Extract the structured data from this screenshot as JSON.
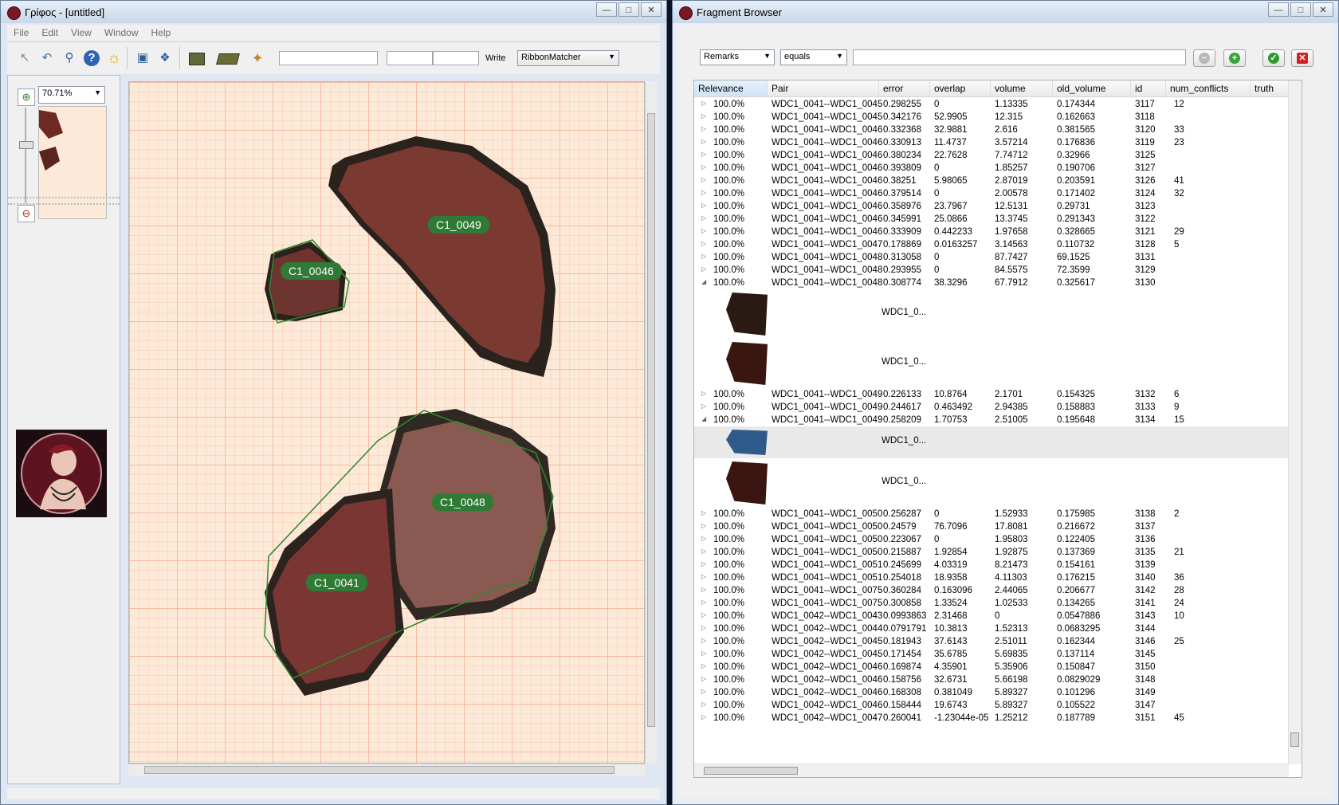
{
  "left_window": {
    "title": "Γρίφος - [untitled]",
    "menu": [
      "File",
      "Edit",
      "View",
      "Window",
      "Help"
    ],
    "toolbar": {
      "write_label": "Write",
      "matcher_select": "RibbonMatcher"
    },
    "zoom": "70.71%",
    "fragments": [
      {
        "id": "C1_0049"
      },
      {
        "id": "C1_0046"
      },
      {
        "id": "C1_0048"
      },
      {
        "id": "C1_0041"
      }
    ]
  },
  "right_window": {
    "title": "Fragment Browser",
    "filter": {
      "field": "Remarks",
      "operator": "equals",
      "value": ""
    },
    "columns": [
      "Relevance",
      "Pair",
      "error",
      "overlap",
      "volume",
      "old_volume",
      "id",
      "num_conflicts",
      "truth"
    ],
    "rows": [
      {
        "type": "row",
        "expanded": false,
        "relevance": "100.0%",
        "pair": "WDC1_0041--WDC1_0045",
        "error": "0.298255",
        "overlap": "0",
        "volume": "1.13335",
        "old_volume": "0.174344",
        "id": "3117",
        "num_conflicts": "12"
      },
      {
        "type": "row",
        "expanded": false,
        "relevance": "100.0%",
        "pair": "WDC1_0041--WDC1_0045",
        "error": "0.342176",
        "overlap": "52.9905",
        "volume": "12.315",
        "old_volume": "0.162663",
        "id": "3118",
        "num_conflicts": ""
      },
      {
        "type": "row",
        "expanded": false,
        "relevance": "100.0%",
        "pair": "WDC1_0041--WDC1_0046",
        "error": "0.332368",
        "overlap": "32.9881",
        "volume": "2.616",
        "old_volume": "0.381565",
        "id": "3120",
        "num_conflicts": "33"
      },
      {
        "type": "row",
        "expanded": false,
        "relevance": "100.0%",
        "pair": "WDC1_0041--WDC1_0046",
        "error": "0.330913",
        "overlap": "11.4737",
        "volume": "3.57214",
        "old_volume": "0.176836",
        "id": "3119",
        "num_conflicts": "23"
      },
      {
        "type": "row",
        "expanded": false,
        "relevance": "100.0%",
        "pair": "WDC1_0041--WDC1_0046",
        "error": "0.380234",
        "overlap": "22.7628",
        "volume": "7.74712",
        "old_volume": "0.32966",
        "id": "3125",
        "num_conflicts": ""
      },
      {
        "type": "row",
        "expanded": false,
        "relevance": "100.0%",
        "pair": "WDC1_0041--WDC1_0046",
        "error": "0.393809",
        "overlap": "0",
        "volume": "1.85257",
        "old_volume": "0.190706",
        "id": "3127",
        "num_conflicts": ""
      },
      {
        "type": "row",
        "expanded": false,
        "relevance": "100.0%",
        "pair": "WDC1_0041--WDC1_0046",
        "error": "0.38251",
        "overlap": "5.98065",
        "volume": "2.87019",
        "old_volume": "0.203591",
        "id": "3126",
        "num_conflicts": "41"
      },
      {
        "type": "row",
        "expanded": false,
        "relevance": "100.0%",
        "pair": "WDC1_0041--WDC1_0046",
        "error": "0.379514",
        "overlap": "0",
        "volume": "2.00578",
        "old_volume": "0.171402",
        "id": "3124",
        "num_conflicts": "32"
      },
      {
        "type": "row",
        "expanded": false,
        "relevance": "100.0%",
        "pair": "WDC1_0041--WDC1_0046",
        "error": "0.358976",
        "overlap": "23.7967",
        "volume": "12.5131",
        "old_volume": "0.29731",
        "id": "3123",
        "num_conflicts": ""
      },
      {
        "type": "row",
        "expanded": false,
        "relevance": "100.0%",
        "pair": "WDC1_0041--WDC1_0046",
        "error": "0.345991",
        "overlap": "25.0866",
        "volume": "13.3745",
        "old_volume": "0.291343",
        "id": "3122",
        "num_conflicts": ""
      },
      {
        "type": "row",
        "expanded": false,
        "relevance": "100.0%",
        "pair": "WDC1_0041--WDC1_0046",
        "error": "0.333909",
        "overlap": "0.442233",
        "volume": "1.97658",
        "old_volume": "0.328665",
        "id": "3121",
        "num_conflicts": "29"
      },
      {
        "type": "row",
        "expanded": false,
        "relevance": "100.0%",
        "pair": "WDC1_0041--WDC1_0047",
        "error": "0.178869",
        "overlap": "0.0163257",
        "volume": "3.14563",
        "old_volume": "0.110732",
        "id": "3128",
        "num_conflicts": "5"
      },
      {
        "type": "row",
        "expanded": false,
        "relevance": "100.0%",
        "pair": "WDC1_0041--WDC1_0048",
        "error": "0.313058",
        "overlap": "0",
        "volume": "87.7427",
        "old_volume": "69.1525",
        "id": "3131",
        "num_conflicts": ""
      },
      {
        "type": "row",
        "expanded": false,
        "relevance": "100.0%",
        "pair": "WDC1_0041--WDC1_0048",
        "error": "0.293955",
        "overlap": "0",
        "volume": "84.5575",
        "old_volume": "72.3599",
        "id": "3129",
        "num_conflicts": ""
      },
      {
        "type": "row",
        "expanded": true,
        "relevance": "100.0%",
        "pair": "WDC1_0041--WDC1_0048",
        "error": "0.308774",
        "overlap": "38.3296",
        "volume": "67.7912",
        "old_volume": "0.325617",
        "id": "3130",
        "num_conflicts": ""
      },
      {
        "type": "sub",
        "label": "WDC1_0...",
        "color": "#2a1a14"
      },
      {
        "type": "sub",
        "label": "WDC1_0...",
        "color": "#3a1610"
      },
      {
        "type": "row",
        "expanded": false,
        "relevance": "100.0%",
        "pair": "WDC1_0041--WDC1_0049",
        "error": "0.226133",
        "overlap": "10.8764",
        "volume": "2.1701",
        "old_volume": "0.154325",
        "id": "3132",
        "num_conflicts": "6"
      },
      {
        "type": "row",
        "expanded": false,
        "relevance": "100.0%",
        "pair": "WDC1_0041--WDC1_0049",
        "error": "0.244617",
        "overlap": "0.463492",
        "volume": "2.94385",
        "old_volume": "0.158883",
        "id": "3133",
        "num_conflicts": "9"
      },
      {
        "type": "row",
        "expanded": true,
        "relevance": "100.0%",
        "pair": "WDC1_0041--WDC1_0049",
        "error": "0.258209",
        "overlap": "1.70753",
        "volume": "2.51005",
        "old_volume": "0.195648",
        "id": "3134",
        "num_conflicts": "15"
      },
      {
        "type": "sub",
        "label": "WDC1_0...",
        "color": "#2d5a88",
        "short": true
      },
      {
        "type": "sub",
        "label": "WDC1_0...",
        "color": "#3a1610"
      },
      {
        "type": "row",
        "expanded": false,
        "relevance": "100.0%",
        "pair": "WDC1_0041--WDC1_0050",
        "error": "0.256287",
        "overlap": "0",
        "volume": "1.52933",
        "old_volume": "0.175985",
        "id": "3138",
        "num_conflicts": "2"
      },
      {
        "type": "row",
        "expanded": false,
        "relevance": "100.0%",
        "pair": "WDC1_0041--WDC1_0050",
        "error": "0.24579",
        "overlap": "76.7096",
        "volume": "17.8081",
        "old_volume": "0.216672",
        "id": "3137",
        "num_conflicts": ""
      },
      {
        "type": "row",
        "expanded": false,
        "relevance": "100.0%",
        "pair": "WDC1_0041--WDC1_0050",
        "error": "0.223067",
        "overlap": "0",
        "volume": "1.95803",
        "old_volume": "0.122405",
        "id": "3136",
        "num_conflicts": ""
      },
      {
        "type": "row",
        "expanded": false,
        "relevance": "100.0%",
        "pair": "WDC1_0041--WDC1_0050",
        "error": "0.215887",
        "overlap": "1.92854",
        "volume": "1.92875",
        "old_volume": "0.137369",
        "id": "3135",
        "num_conflicts": "21"
      },
      {
        "type": "row",
        "expanded": false,
        "relevance": "100.0%",
        "pair": "WDC1_0041--WDC1_0051",
        "error": "0.245699",
        "overlap": "4.03319",
        "volume": "8.21473",
        "old_volume": "0.154161",
        "id": "3139",
        "num_conflicts": ""
      },
      {
        "type": "row",
        "expanded": false,
        "relevance": "100.0%",
        "pair": "WDC1_0041--WDC1_0051",
        "error": "0.254018",
        "overlap": "18.9358",
        "volume": "4.11303",
        "old_volume": "0.176215",
        "id": "3140",
        "num_conflicts": "36"
      },
      {
        "type": "row",
        "expanded": false,
        "relevance": "100.0%",
        "pair": "WDC1_0041--WDC1_0075",
        "error": "0.360284",
        "overlap": "0.163096",
        "volume": "2.44065",
        "old_volume": "0.206677",
        "id": "3142",
        "num_conflicts": "28"
      },
      {
        "type": "row",
        "expanded": false,
        "relevance": "100.0%",
        "pair": "WDC1_0041--WDC1_0075",
        "error": "0.300858",
        "overlap": "1.33524",
        "volume": "1.02533",
        "old_volume": "0.134265",
        "id": "3141",
        "num_conflicts": "24"
      },
      {
        "type": "row",
        "expanded": false,
        "relevance": "100.0%",
        "pair": "WDC1_0042--WDC1_0043",
        "error": "0.0993863",
        "overlap": "2.31468",
        "volume": "0",
        "old_volume": "0.0547886",
        "id": "3143",
        "num_conflicts": "10"
      },
      {
        "type": "row",
        "expanded": false,
        "relevance": "100.0%",
        "pair": "WDC1_0042--WDC1_0044",
        "error": "0.0791791",
        "overlap": "10.3813",
        "volume": "1.52313",
        "old_volume": "0.0683295",
        "id": "3144",
        "num_conflicts": ""
      },
      {
        "type": "row",
        "expanded": false,
        "relevance": "100.0%",
        "pair": "WDC1_0042--WDC1_0045",
        "error": "0.181943",
        "overlap": "37.6143",
        "volume": "2.51011",
        "old_volume": "0.162344",
        "id": "3146",
        "num_conflicts": "25"
      },
      {
        "type": "row",
        "expanded": false,
        "relevance": "100.0%",
        "pair": "WDC1_0042--WDC1_0045",
        "error": "0.171454",
        "overlap": "35.6785",
        "volume": "5.69835",
        "old_volume": "0.137114",
        "id": "3145",
        "num_conflicts": ""
      },
      {
        "type": "row",
        "expanded": false,
        "relevance": "100.0%",
        "pair": "WDC1_0042--WDC1_0046",
        "error": "0.169874",
        "overlap": "4.35901",
        "volume": "5.35906",
        "old_volume": "0.150847",
        "id": "3150",
        "num_conflicts": ""
      },
      {
        "type": "row",
        "expanded": false,
        "relevance": "100.0%",
        "pair": "WDC1_0042--WDC1_0046",
        "error": "0.158756",
        "overlap": "32.6731",
        "volume": "5.66198",
        "old_volume": "0.0829029",
        "id": "3148",
        "num_conflicts": ""
      },
      {
        "type": "row",
        "expanded": false,
        "relevance": "100.0%",
        "pair": "WDC1_0042--WDC1_0046",
        "error": "0.168308",
        "overlap": "0.381049",
        "volume": "5.89327",
        "old_volume": "0.101296",
        "id": "3149",
        "num_conflicts": ""
      },
      {
        "type": "row",
        "expanded": false,
        "relevance": "100.0%",
        "pair": "WDC1_0042--WDC1_0046",
        "error": "0.158444",
        "overlap": "19.6743",
        "volume": "5.89327",
        "old_volume": "0.105522",
        "id": "3147",
        "num_conflicts": ""
      },
      {
        "type": "row",
        "expanded": false,
        "relevance": "100.0%",
        "pair": "WDC1_0042--WDC1_0047",
        "error": "0.260041",
        "overlap": "-1.23044e-05",
        "volume": "1.25212",
        "old_volume": "0.187789",
        "id": "3151",
        "num_conflicts": "45"
      }
    ]
  }
}
